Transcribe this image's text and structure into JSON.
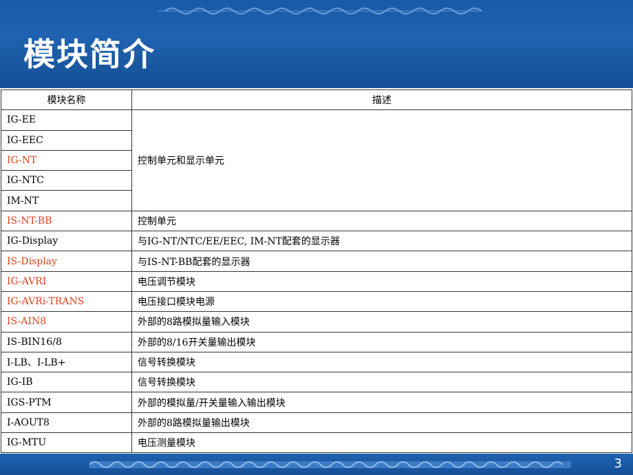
{
  "slide": {
    "title": "模块简介",
    "page_number": "3"
  },
  "table": {
    "headers": [
      "模块名称",
      "描述"
    ],
    "rows": [
      {
        "name": "IG-EE",
        "highlight": false
      },
      {
        "name": "IG-EEC",
        "highlight": false
      },
      {
        "name": "IG-NT",
        "highlight": true
      },
      {
        "name": "IG-NTC",
        "highlight": false
      },
      {
        "name": "IM-NT",
        "highlight": false
      },
      {
        "name": "IS-NT-BB",
        "desc": "控制单元",
        "highlight": true
      },
      {
        "name": "IG-Display",
        "desc": "与IG-NT/NTC/EE/EEC, IM-NT配套的显示器",
        "highlight": false
      },
      {
        "name": "IS-Display",
        "desc": "与IS-NT-BB配套的显示器",
        "highlight": true
      },
      {
        "name": "IG-AVRI",
        "desc": "电压调节模块",
        "highlight": true
      },
      {
        "name": "IG-AVRi-TRANS",
        "desc": "电压接口模块电源",
        "highlight": true
      },
      {
        "name": "IS-AIN8",
        "desc": "外部的8路模拟量输入模块",
        "highlight": true
      },
      {
        "name": "IS-BIN16/8",
        "desc": "外部的8/16开关量输出模块",
        "highlight": false
      },
      {
        "name": "I-LB、I-LB+",
        "desc": "信号转换模块",
        "highlight": false
      },
      {
        "name": "IG-IB",
        "desc": "信号转换模块",
        "highlight": false
      },
      {
        "name": "IGS-PTM",
        "desc": "外部的模拟量/开关量输入输出模块",
        "highlight": false
      },
      {
        "name": "I-AOUT8",
        "desc": "外部的8路模拟量输出模块",
        "highlight": false
      },
      {
        "name": "IG-MTU",
        "desc": "电压测量模块",
        "highlight": false
      }
    ],
    "merged_desc": "控制单元和显示单元"
  },
  "colors": {
    "header_blue": "#1f63b0",
    "highlight_red": "#e0401e"
  }
}
